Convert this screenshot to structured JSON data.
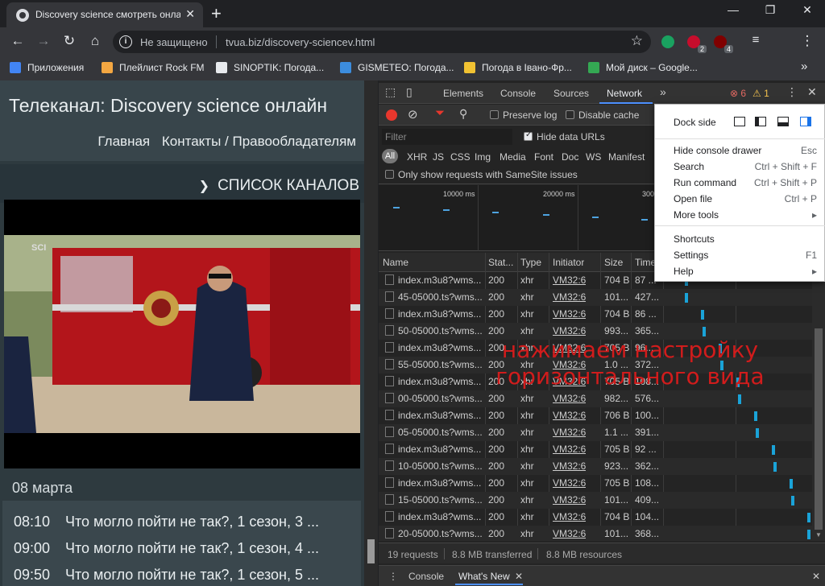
{
  "browser": {
    "tab_title": "Discovery science смотреть онлайн",
    "window_controls": [
      "—",
      "❐",
      "✕"
    ],
    "omnibox": {
      "security": "Не защищено",
      "url": "tvua.biz/discovery-sciencev.html"
    },
    "extensions": [
      {
        "name": "check-icon",
        "color": "#1aa260"
      },
      {
        "name": "abp-icon",
        "color": "#c70d2c",
        "badge": "2"
      },
      {
        "name": "ublock-icon",
        "color": "#800000",
        "badge": "4"
      }
    ],
    "bookmarks": [
      {
        "label": "Приложения",
        "color": "#4285f4"
      },
      {
        "label": "Плейлист Rock FM",
        "color": "#f4a742"
      },
      {
        "label": "SINOPTIK: Погода...",
        "color": "#e8eaed"
      },
      {
        "label": "GISMETEO: Погода...",
        "color": "#3c8dde"
      },
      {
        "label": "Погода в Івано-Фр...",
        "color": "#f1c232"
      },
      {
        "label": "Мой диск – Google...",
        "color": "#34a853"
      }
    ],
    "bookmarks_more": "»"
  },
  "page": {
    "title": "Телеканал: Discovery science онлайн",
    "nav": [
      "Главная",
      "Контакты / Правообладателям"
    ],
    "channels_label": "СПИСОК КАНАЛОВ",
    "date": "08 марта",
    "schedule": [
      {
        "time": "08:10",
        "title": "Что могло пойти не так?, 1 сезон, 3 ..."
      },
      {
        "time": "09:00",
        "title": "Что могло пойти не так?, 1 сезон, 4 ..."
      },
      {
        "time": "09:50",
        "title": "Что могло пойти не так?, 1 сезон, 5 ..."
      }
    ],
    "player_logo": "SCI"
  },
  "devtools": {
    "tabs": [
      "Elements",
      "Console",
      "Sources",
      "Network"
    ],
    "more_tabs": "»",
    "errors": "6",
    "warnings": "1",
    "toolbar": {
      "preserve_log": "Preserve log",
      "disable_cache": "Disable cache"
    },
    "filter_placeholder": "Filter",
    "hide_data_urls": "Hide data URLs",
    "types": [
      "All",
      "XHR",
      "JS",
      "CSS",
      "Img",
      "Media",
      "Font",
      "Doc",
      "WS",
      "Manifest"
    ],
    "same_site": "Only show requests with SameSite issues",
    "overview_labels": [
      "10000 ms",
      "20000 ms",
      "300"
    ],
    "columns": [
      "Name",
      "Stat...",
      "Type",
      "Initiator",
      "Size",
      "Time"
    ],
    "requests": [
      {
        "name": "index.m3u8?wms...",
        "status": "200",
        "type": "xhr",
        "initiator": "VM32:6",
        "size": "704 B",
        "time": "87 ..."
      },
      {
        "name": "45-05000.ts?wms...",
        "status": "200",
        "type": "xhr",
        "initiator": "VM32:6",
        "size": "101...",
        "time": "427..."
      },
      {
        "name": "index.m3u8?wms...",
        "status": "200",
        "type": "xhr",
        "initiator": "VM32:6",
        "size": "704 B",
        "time": "86 ..."
      },
      {
        "name": "50-05000.ts?wms...",
        "status": "200",
        "type": "xhr",
        "initiator": "VM32:6",
        "size": "993...",
        "time": "365..."
      },
      {
        "name": "index.m3u8?wms...",
        "status": "200",
        "type": "xhr",
        "initiator": "VM32:6",
        "size": "705 B",
        "time": "96..."
      },
      {
        "name": "55-05000.ts?wms...",
        "status": "200",
        "type": "xhr",
        "initiator": "VM32:6",
        "size": "1.0 ...",
        "time": "372..."
      },
      {
        "name": "index.m3u8?wms...",
        "status": "200",
        "type": "xhr",
        "initiator": "VM32:6",
        "size": "705 B",
        "time": "108..."
      },
      {
        "name": "00-05000.ts?wms...",
        "status": "200",
        "type": "xhr",
        "initiator": "VM32:6",
        "size": "982...",
        "time": "576..."
      },
      {
        "name": "index.m3u8?wms...",
        "status": "200",
        "type": "xhr",
        "initiator": "VM32:6",
        "size": "706 B",
        "time": "100..."
      },
      {
        "name": "05-05000.ts?wms...",
        "status": "200",
        "type": "xhr",
        "initiator": "VM32:6",
        "size": "1.1 ...",
        "time": "391..."
      },
      {
        "name": "index.m3u8?wms...",
        "status": "200",
        "type": "xhr",
        "initiator": "VM32:6",
        "size": "705 B",
        "time": "92 ..."
      },
      {
        "name": "10-05000.ts?wms...",
        "status": "200",
        "type": "xhr",
        "initiator": "VM32:6",
        "size": "923...",
        "time": "362..."
      },
      {
        "name": "index.m3u8?wms...",
        "status": "200",
        "type": "xhr",
        "initiator": "VM32:6",
        "size": "705 B",
        "time": "108..."
      },
      {
        "name": "15-05000.ts?wms...",
        "status": "200",
        "type": "xhr",
        "initiator": "VM32:6",
        "size": "101...",
        "time": "409..."
      },
      {
        "name": "index.m3u8?wms...",
        "status": "200",
        "type": "xhr",
        "initiator": "VM32:6",
        "size": "704 B",
        "time": "104..."
      },
      {
        "name": "20-05000.ts?wms...",
        "status": "200",
        "type": "xhr",
        "initiator": "VM32:6",
        "size": "101...",
        "time": "368..."
      }
    ],
    "status_bar": [
      "19 requests",
      "8.8 MB transferred",
      "8.8 MB resources"
    ],
    "drawer_tabs": [
      "Console",
      "What's New"
    ],
    "annotation": "нажимаем настройку горизонтального вида",
    "menu": {
      "dock_side": "Dock side",
      "items_a": [
        {
          "label": "Hide console drawer",
          "key": "Esc"
        },
        {
          "label": "Search",
          "key": "Ctrl + Shift + F"
        },
        {
          "label": "Run command",
          "key": "Ctrl + Shift + P"
        },
        {
          "label": "Open file",
          "key": "Ctrl + P"
        },
        {
          "label": "More tools",
          "key": "▸"
        }
      ],
      "items_b": [
        {
          "label": "Shortcuts",
          "key": ""
        },
        {
          "label": "Settings",
          "key": "F1"
        },
        {
          "label": "Help",
          "key": "▸"
        }
      ]
    }
  }
}
